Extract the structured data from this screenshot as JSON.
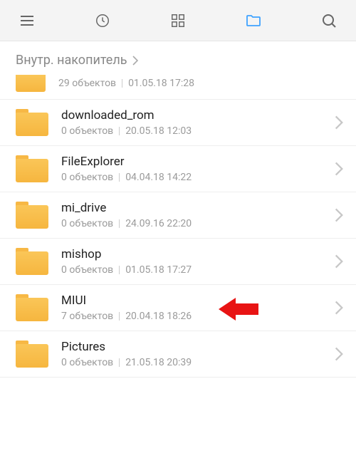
{
  "toolbar": {
    "menu": "menu",
    "recent": "recent",
    "grid": "grid",
    "folder": "folder",
    "search": "search"
  },
  "breadcrumb": {
    "label": "Внутр. накопитель"
  },
  "partial_top": {
    "count": "29 объектов",
    "date": "01.05.18 17:28"
  },
  "folders": [
    {
      "name": "downloaded_rom",
      "count": "0 объектов",
      "date": "20.05.18 12:03",
      "highlight": false
    },
    {
      "name": "FileExplorer",
      "count": "0 объектов",
      "date": "04.04.18 14:22",
      "highlight": false
    },
    {
      "name": "mi_drive",
      "count": "0 объектов",
      "date": "24.09.16 22:20",
      "highlight": false
    },
    {
      "name": "mishop",
      "count": "0 объектов",
      "date": "01.05.18 17:27",
      "highlight": false
    },
    {
      "name": "MIUI",
      "count": "7 объектов",
      "date": "20.04.18 18:26",
      "highlight": true
    },
    {
      "name": "Pictures",
      "count": "0 объектов",
      "date": "21.05.18 20:39",
      "highlight": false
    }
  ]
}
